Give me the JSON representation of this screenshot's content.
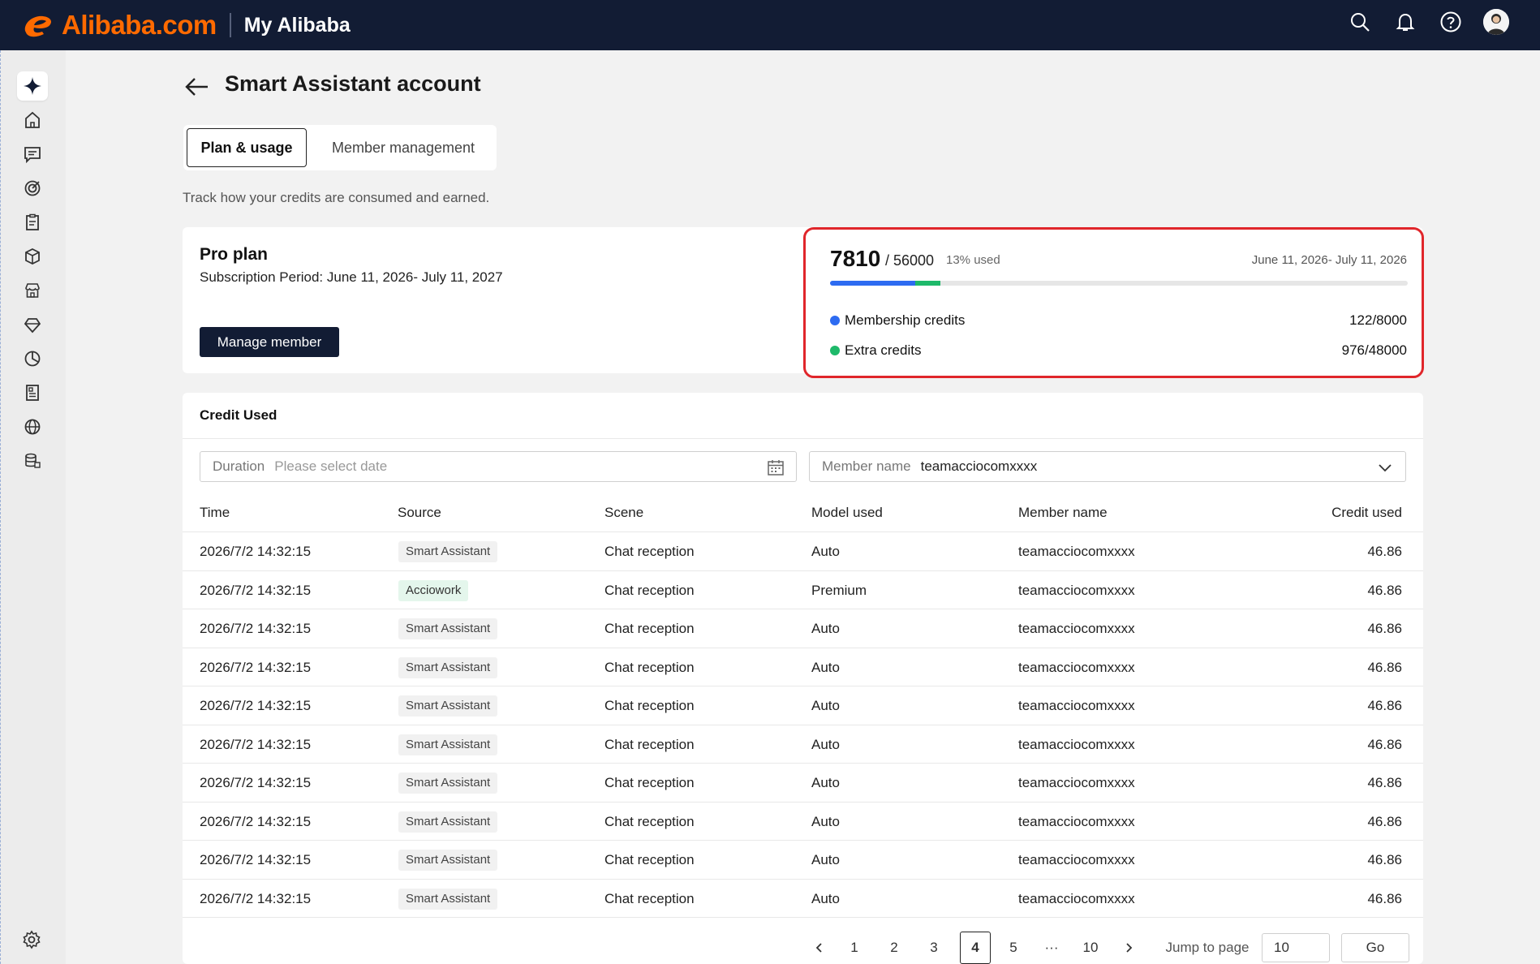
{
  "header": {
    "brand": "Alibaba.com",
    "section": "My Alibaba",
    "icons": [
      "search-icon",
      "bell-icon",
      "help-icon",
      "avatar"
    ]
  },
  "sidebar": {
    "items": [
      "sparkle-icon",
      "home-icon",
      "message-icon",
      "target-icon",
      "clipboard-icon",
      "box-icon",
      "store-icon",
      "tag-icon",
      "chart-pie-icon",
      "report-icon",
      "globe-icon",
      "database-icon"
    ],
    "footer_icon": "gear-icon"
  },
  "page": {
    "title": "Smart Assistant account",
    "tabs": [
      {
        "label": "Plan & usage",
        "active": true
      },
      {
        "label": "Member management",
        "active": false
      }
    ],
    "subtitle": "Track how your credits are consumed and earned."
  },
  "plan": {
    "name": "Pro plan",
    "period": "Subscription Period: June 11, 2026- July 11, 2027",
    "manage_label": "Manage member"
  },
  "credits": {
    "used": "7810",
    "total": "/ 56000",
    "pct_label": "13% used",
    "range": "June 11, 2026- July 11, 2026",
    "bar": {
      "blue_fraction": 0.148,
      "green_fraction": 0.043
    },
    "rows": [
      {
        "label": "Membership credits",
        "value": "122/8000",
        "color": "#2d6bf1"
      },
      {
        "label": "Extra credits",
        "value": "976/48000",
        "color": "#1eb96a"
      }
    ]
  },
  "usage": {
    "title": "Credit Used",
    "duration": {
      "label": "Duration",
      "placeholder": "Please select date"
    },
    "member": {
      "label": "Member name",
      "value": "teamacciocomxxxx"
    },
    "columns": [
      "Time",
      "Source",
      "Scene",
      "Model used",
      "Member name",
      "Credit used"
    ],
    "rows": [
      {
        "time": "2026/7/2 14:32:15",
        "source": "Smart Assistant",
        "scene": "Chat reception",
        "model": "Auto",
        "member": "teamacciocomxxxx",
        "credit": "46.86"
      },
      {
        "time": "2026/7/2 14:32:15",
        "source": "Acciowork",
        "scene": "Chat reception",
        "model": "Premium",
        "member": "teamacciocomxxxx",
        "credit": "46.86"
      },
      {
        "time": "2026/7/2 14:32:15",
        "source": "Smart Assistant",
        "scene": "Chat reception",
        "model": "Auto",
        "member": "teamacciocomxxxx",
        "credit": "46.86"
      },
      {
        "time": "2026/7/2 14:32:15",
        "source": "Smart Assistant",
        "scene": "Chat reception",
        "model": "Auto",
        "member": "teamacciocomxxxx",
        "credit": "46.86"
      },
      {
        "time": "2026/7/2 14:32:15",
        "source": "Smart Assistant",
        "scene": "Chat reception",
        "model": "Auto",
        "member": "teamacciocomxxxx",
        "credit": "46.86"
      },
      {
        "time": "2026/7/2 14:32:15",
        "source": "Smart Assistant",
        "scene": "Chat reception",
        "model": "Auto",
        "member": "teamacciocomxxxx",
        "credit": "46.86"
      },
      {
        "time": "2026/7/2 14:32:15",
        "source": "Smart Assistant",
        "scene": "Chat reception",
        "model": "Auto",
        "member": "teamacciocomxxxx",
        "credit": "46.86"
      },
      {
        "time": "2026/7/2 14:32:15",
        "source": "Smart Assistant",
        "scene": "Chat reception",
        "model": "Auto",
        "member": "teamacciocomxxxx",
        "credit": "46.86"
      },
      {
        "time": "2026/7/2 14:32:15",
        "source": "Smart Assistant",
        "scene": "Chat reception",
        "model": "Auto",
        "member": "teamacciocomxxxx",
        "credit": "46.86"
      },
      {
        "time": "2026/7/2 14:32:15",
        "source": "Smart Assistant",
        "scene": "Chat reception",
        "model": "Auto",
        "member": "teamacciocomxxxx",
        "credit": "46.86"
      }
    ]
  },
  "pagination": {
    "pages": [
      "1",
      "2",
      "3",
      "4",
      "5",
      "···",
      "10"
    ],
    "current": "4",
    "jump_label": "Jump to page",
    "jump_value": "10",
    "go_label": "Go"
  }
}
